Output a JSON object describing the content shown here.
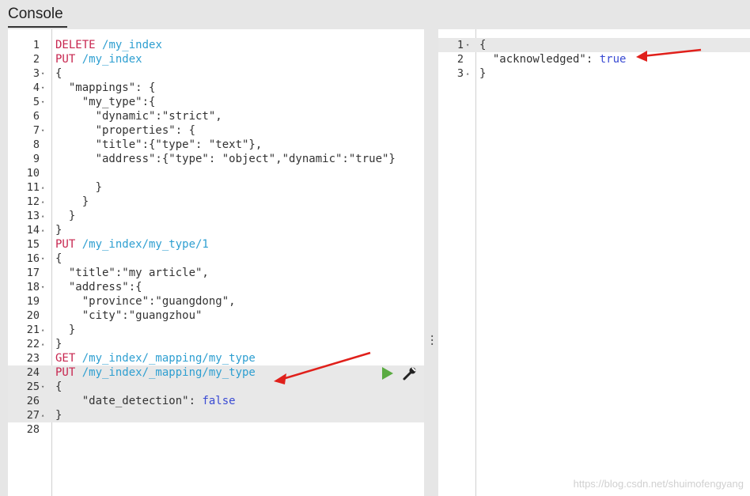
{
  "header": {
    "tab_label": "Console"
  },
  "editor": {
    "lines": [
      {
        "n": "1",
        "fold": "",
        "parts": [
          [
            "m",
            "DELETE "
          ],
          [
            "u",
            "/my_index"
          ]
        ]
      },
      {
        "n": "2",
        "fold": "",
        "parts": [
          [
            "m",
            "PUT "
          ],
          [
            "u",
            "/my_index"
          ]
        ]
      },
      {
        "n": "3",
        "fold": "▾",
        "parts": [
          [
            "plain",
            "{"
          ]
        ]
      },
      {
        "n": "4",
        "fold": "▾",
        "parts": [
          [
            "plain",
            "  \"mappings\": {"
          ]
        ]
      },
      {
        "n": "5",
        "fold": "▾",
        "parts": [
          [
            "plain",
            "    \"my_type\":{"
          ]
        ]
      },
      {
        "n": "6",
        "fold": "",
        "parts": [
          [
            "plain",
            "      \"dynamic\":\"strict\","
          ]
        ]
      },
      {
        "n": "7",
        "fold": "▾",
        "parts": [
          [
            "plain",
            "      \"properties\": {"
          ]
        ]
      },
      {
        "n": "8",
        "fold": "",
        "parts": [
          [
            "plain",
            "      \"title\":{\"type\": \"text\"},"
          ]
        ]
      },
      {
        "n": "9",
        "fold": "",
        "parts": [
          [
            "plain",
            "      \"address\":{\"type\": \"object\",\"dynamic\":\"true\"}"
          ]
        ]
      },
      {
        "n": "10",
        "fold": "",
        "parts": [
          [
            "plain",
            ""
          ]
        ]
      },
      {
        "n": "11",
        "fold": "▴",
        "parts": [
          [
            "plain",
            "      }"
          ]
        ]
      },
      {
        "n": "12",
        "fold": "▴",
        "parts": [
          [
            "plain",
            "    }"
          ]
        ]
      },
      {
        "n": "13",
        "fold": "▴",
        "parts": [
          [
            "plain",
            "  }"
          ]
        ]
      },
      {
        "n": "14",
        "fold": "▴",
        "parts": [
          [
            "plain",
            "}"
          ]
        ]
      },
      {
        "n": "15",
        "fold": "",
        "parts": [
          [
            "m",
            "PUT "
          ],
          [
            "u",
            "/my_index/my_type/1"
          ]
        ]
      },
      {
        "n": "16",
        "fold": "▾",
        "parts": [
          [
            "plain",
            "{"
          ]
        ]
      },
      {
        "n": "17",
        "fold": "",
        "parts": [
          [
            "plain",
            "  \"title\":\"my article\","
          ]
        ]
      },
      {
        "n": "18",
        "fold": "▾",
        "parts": [
          [
            "plain",
            "  \"address\":{"
          ]
        ]
      },
      {
        "n": "19",
        "fold": "",
        "parts": [
          [
            "plain",
            "    \"province\":\"guangdong\","
          ]
        ]
      },
      {
        "n": "20",
        "fold": "",
        "parts": [
          [
            "plain",
            "    \"city\":\"guangzhou\""
          ]
        ]
      },
      {
        "n": "21",
        "fold": "▴",
        "parts": [
          [
            "plain",
            "  }"
          ]
        ]
      },
      {
        "n": "22",
        "fold": "▴",
        "parts": [
          [
            "plain",
            "}"
          ]
        ]
      },
      {
        "n": "23",
        "fold": "",
        "parts": [
          [
            "m",
            "GET "
          ],
          [
            "u",
            "/my_index/_mapping/my_type"
          ]
        ]
      },
      {
        "n": "24",
        "fold": "",
        "parts": [
          [
            "m",
            "PUT "
          ],
          [
            "u",
            "/my_index/_mapping/my_type"
          ]
        ]
      },
      {
        "n": "25",
        "fold": "▾",
        "parts": [
          [
            "plain",
            "{"
          ]
        ]
      },
      {
        "n": "26",
        "fold": "",
        "parts": [
          [
            "plain",
            "    \"date_detection\": "
          ],
          [
            "kw",
            "false"
          ]
        ]
      },
      {
        "n": "27",
        "fold": "▴",
        "parts": [
          [
            "plain",
            "}"
          ]
        ]
      },
      {
        "n": "28",
        "fold": "",
        "parts": [
          [
            "plain",
            ""
          ]
        ]
      }
    ]
  },
  "response": {
    "lines": [
      {
        "n": "1",
        "fold": "▾",
        "parts": [
          [
            "plain",
            "{"
          ]
        ]
      },
      {
        "n": "2",
        "fold": "",
        "parts": [
          [
            "plain",
            "  \"acknowledged\": "
          ],
          [
            "kw",
            "true"
          ]
        ]
      },
      {
        "n": "3",
        "fold": "▴",
        "parts": [
          [
            "plain",
            "}"
          ]
        ]
      }
    ]
  },
  "actions": {
    "run_icon": "play-icon",
    "settings_icon": "wrench-icon"
  },
  "watermark": "https://blog.csdn.net/shuimofengyang",
  "colors": {
    "method": "#c7254e",
    "url": "#2e9fd1",
    "keyword": "#3a4bd3",
    "run": "#5aab41",
    "arrow": "#e0201b"
  }
}
